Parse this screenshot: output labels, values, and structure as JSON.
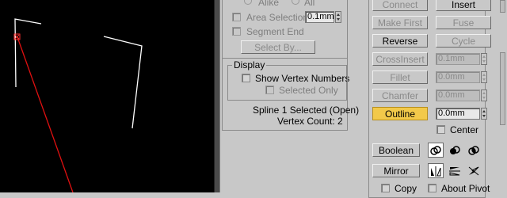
{
  "selection_options": {
    "radio_alike": "Alike",
    "radio_all": "All",
    "area_selection_label": "Area Selection:",
    "area_selection_value": "0.1mm",
    "segment_end_label": "Segment End",
    "select_by_label": "Select By..."
  },
  "display": {
    "title": "Display",
    "show_vertex_numbers_label": "Show Vertex Numbers",
    "selected_only_label": "Selected Only"
  },
  "status": {
    "selection_text": "Spline 1 Selected (Open)",
    "vertex_count_text": "Vertex Count: 2"
  },
  "geometry": {
    "connect_label": "Connect",
    "insert_label": "Insert",
    "make_first_label": "Make First",
    "fuse_label": "Fuse",
    "reverse_label": "Reverse",
    "cycle_label": "Cycle",
    "crossinsert_label": "CrossInsert",
    "crossinsert_value": "0.1mm",
    "fillet_label": "Fillet",
    "fillet_value": "0.0mm",
    "chamfer_label": "Chamfer",
    "chamfer_value": "0.0mm",
    "outline_label": "Outline",
    "outline_value": "0.0mm",
    "center_label": "Center",
    "boolean_label": "Boolean",
    "mirror_label": "Mirror",
    "copy_label": "Copy",
    "about_pivot_label": "About Pivot"
  },
  "icons": [
    "boolean-union-icon",
    "boolean-subtract-icon",
    "boolean-intersect-icon",
    "mirror-horizontal-icon",
    "mirror-vertical-icon",
    "mirror-both-icon"
  ],
  "colors": {
    "active_button": "#f2c94a",
    "viewport_bg": "#000000",
    "spline_selected": "#ff0000",
    "spline": "#ffffff"
  }
}
